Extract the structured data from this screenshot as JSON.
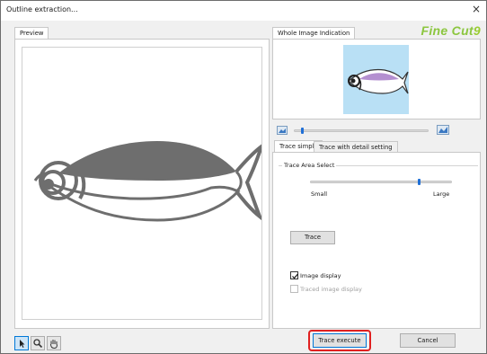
{
  "window": {
    "title": "Outline extraction...",
    "close_glyph": "×"
  },
  "left_panel": {
    "tab_label": "Preview"
  },
  "right_panel": {
    "whole_tab_label": "Whole Image Indication",
    "logo_main": "Fine Cut",
    "logo_number": "9",
    "zoom_slider": {
      "level": 0.05
    },
    "tabs": [
      {
        "label": "Trace simply",
        "active": true
      },
      {
        "label": "Trace with detail setting",
        "active": false
      }
    ],
    "trace_area": {
      "group_label": "Trace Area Select",
      "small_label": "Small",
      "large_label": "Large",
      "level": 0.76
    },
    "trace_button_label": "Trace",
    "image_display": {
      "label": "Image display",
      "checked": true
    },
    "traced_display": {
      "label": "Traced image display",
      "checked": false,
      "enabled": false
    }
  },
  "footer": {
    "execute_label": "Trace execute",
    "cancel_label": "Cancel"
  },
  "tools": [
    {
      "icon": "arrow-pointer-icon",
      "active": true
    },
    {
      "icon": "magnifier-icon",
      "active": false
    },
    {
      "icon": "hand-icon",
      "active": false
    }
  ],
  "colors": {
    "overview_bg": "#b9e0f5",
    "fish_fill": "#6e6e6e",
    "fish_accent": "#b48fd0",
    "highlight": "#e02020",
    "logo": "#8cc63f"
  }
}
